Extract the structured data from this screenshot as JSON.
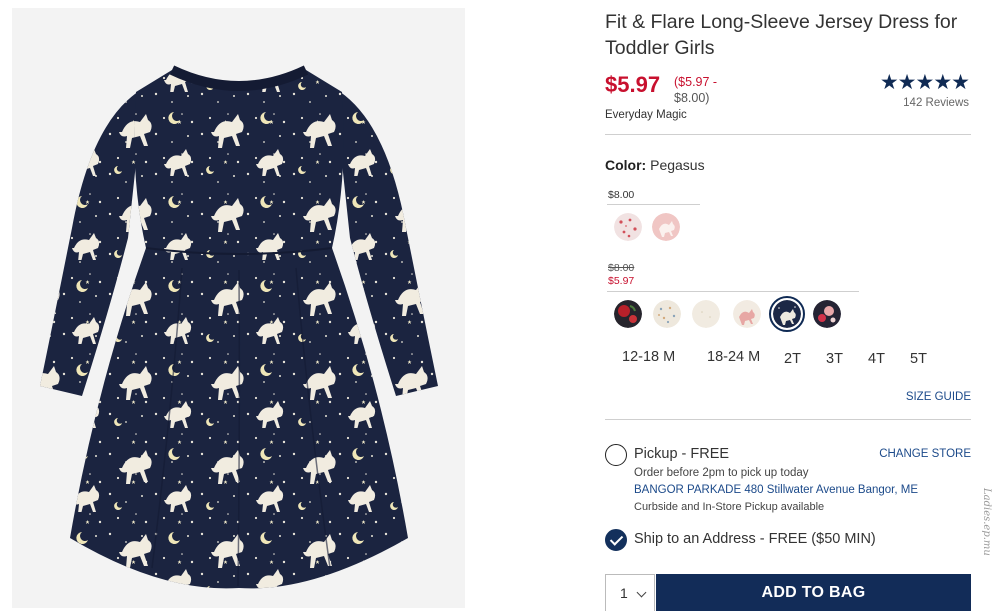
{
  "product": {
    "title": "Fit & Flare Long-Sleeve Jersey Dress for Toddler Girls",
    "sale_price": "$5.97",
    "range_line1": "($5.97 -",
    "range_line2": "$8.00)",
    "promo": "Everyday Magic",
    "rating_stars": "★★★★★",
    "reviews": "142 Reviews"
  },
  "color": {
    "label": "Color:",
    "selected": "Pegasus",
    "group1": {
      "price": "$8.00"
    },
    "group2": {
      "orig_price": "$8.00",
      "sale_price": "$5.97"
    },
    "swatches_group1": [
      {
        "name": "dotted-pink",
        "color": "#f1e0e0"
      },
      {
        "name": "pink-floral",
        "color": "#f0c2c2"
      }
    ],
    "swatches_group2": [
      {
        "name": "navy-roses",
        "color": "#2a2a34"
      },
      {
        "name": "cream-dots",
        "color": "#efe9df"
      },
      {
        "name": "cream-plain",
        "color": "#f2ece3"
      },
      {
        "name": "cream-unicorn",
        "color": "#f3ebe2"
      },
      {
        "name": "pegasus",
        "color": "#1d2a4a"
      },
      {
        "name": "navy-floral",
        "color": "#262535"
      }
    ]
  },
  "sizes": [
    "12-18 M",
    "18-24 M",
    "2T",
    "3T",
    "4T",
    "5T"
  ],
  "size_guide": "SIZE GUIDE",
  "pickup": {
    "label": "Pickup - FREE",
    "change_store": "CHANGE STORE",
    "order_note": "Order before 2pm to pick up today",
    "store": "BANGOR PARKADE 480 Stillwater Avenue  Bangor, ME",
    "availability": "Curbside and In-Store Pickup available"
  },
  "ship": {
    "label": "Ship to an Address - FREE ($50 MIN)"
  },
  "cart": {
    "quantity": "1",
    "add_label": "ADD TO BAG"
  },
  "watermark": "Ladies.ep.mu",
  "colors": {
    "accent_red": "#c8102e",
    "navy": "#122c58",
    "link_blue": "#1c4a8a"
  }
}
